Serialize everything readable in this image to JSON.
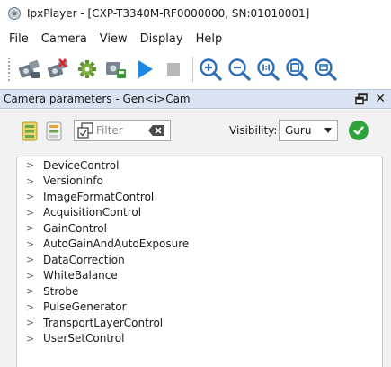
{
  "window": {
    "title": "IpxPlayer -  [CXP-T3340M-RF0000000, SN:01010001]"
  },
  "menu": [
    "File",
    "Camera",
    "View",
    "Display",
    "Help"
  ],
  "toolbar": {
    "buttons": [
      "connect-camera-icon",
      "disconnect-camera-icon",
      "camera-settings-icon",
      "save-image-icon",
      "play-icon",
      "stop-icon",
      "zoom-in-icon",
      "zoom-out-icon",
      "zoom-1to1-icon",
      "zoom-fit-icon",
      "zoom-window-icon"
    ]
  },
  "panel": {
    "title": "Camera parameters - Gen<i>Cam",
    "close_label": "✕"
  },
  "filter": {
    "placeholder": "Filter"
  },
  "visibility": {
    "label": "Visibility:",
    "value": "Guru"
  },
  "tree": {
    "items": [
      "DeviceControl",
      "VersionInfo",
      "ImageFormatControl",
      "AcquisitionControl",
      "GainControl",
      "AutoGainAndAutoExposure",
      "DataCorrection",
      "WhiteBalance",
      "Strobe",
      "PulseGenerator",
      "TransportLayerControl",
      "UserSetControl"
    ]
  },
  "colors": {
    "panel_header": "#d9e3f1",
    "play_blue": "#1e88e5",
    "apply_green": "#2fa23d",
    "zoom_blue": "#2f6db5"
  }
}
